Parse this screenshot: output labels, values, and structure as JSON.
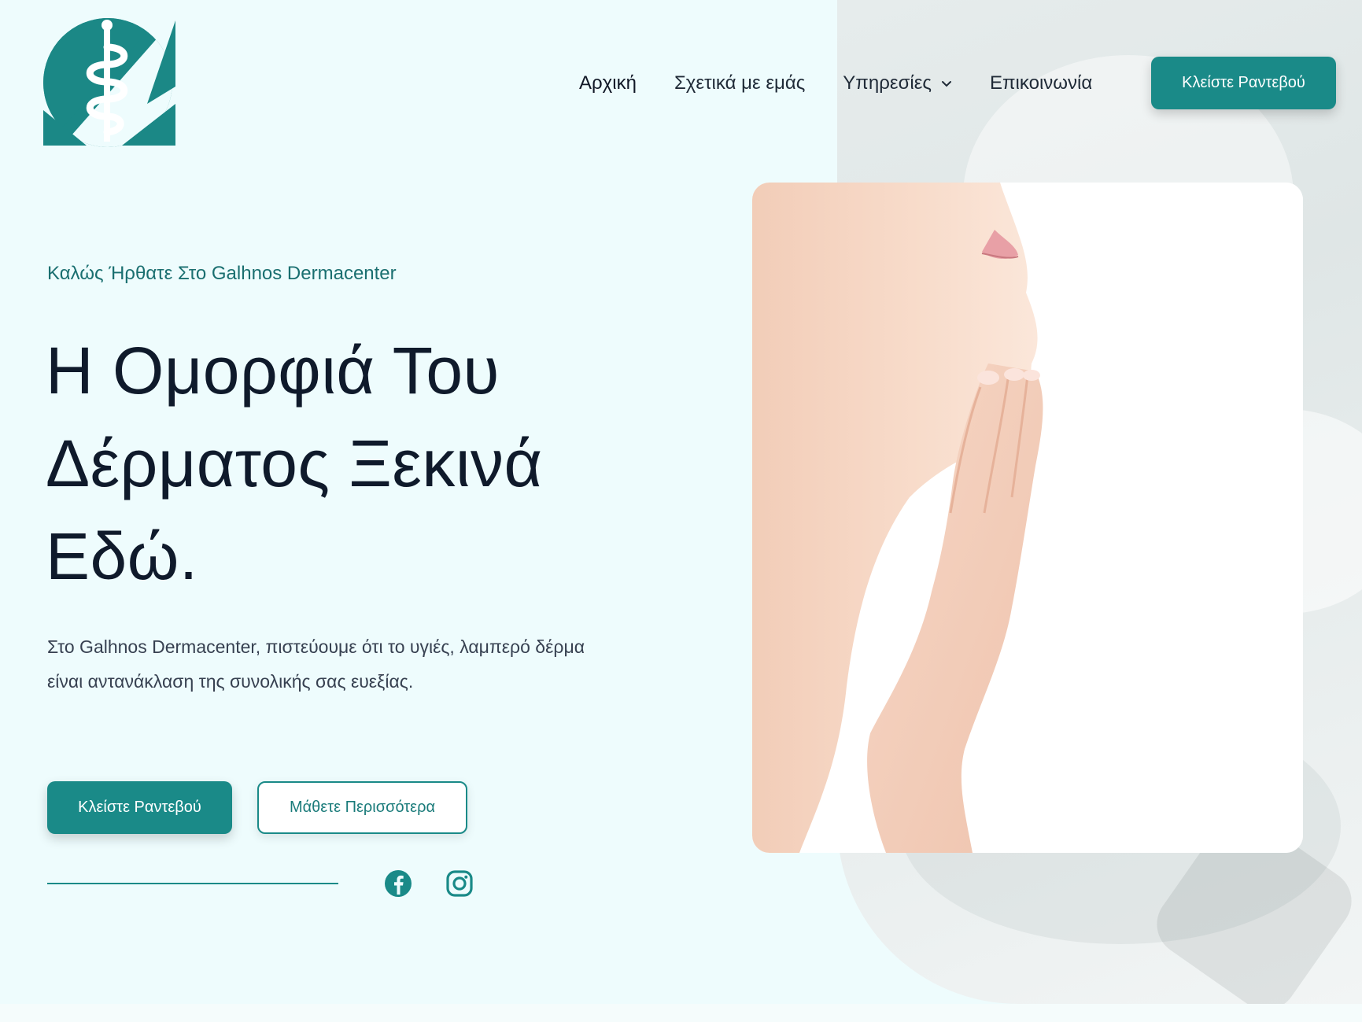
{
  "brand": {
    "logo_name": "Galhnos Dermacenter logo",
    "accent_color": "#1a8a88"
  },
  "nav": {
    "items": [
      {
        "label": "Αρχική"
      },
      {
        "label": "Σχετικά με εμάς"
      },
      {
        "label": "Υπηρεσίες",
        "has_dropdown": true
      },
      {
        "label": "Επικοινωνία"
      }
    ],
    "cta_label": "Κλείστε Ραντεβού"
  },
  "hero": {
    "eyebrow": "Καλώς Ήρθατε Στο Galhnos Dermacenter",
    "headline_lines": [
      "Η Ομορφιά Του",
      "Δέρματος Ξεκινά",
      "Εδώ."
    ],
    "lead_lines": [
      "Στο Galhnos Dermacenter, πιστεύουμε ότι το υγιές, λαμπερό δέρμα",
      "είναι αντανάκλαση της συνολικής σας ευεξίας."
    ],
    "primary_button": "Κλείστε Ραντεβού",
    "secondary_button": "Μάθετε Περισσότερα",
    "image": "woman touching neck skin"
  },
  "social": [
    {
      "icon": "facebook-icon"
    },
    {
      "icon": "instagram-icon"
    }
  ]
}
